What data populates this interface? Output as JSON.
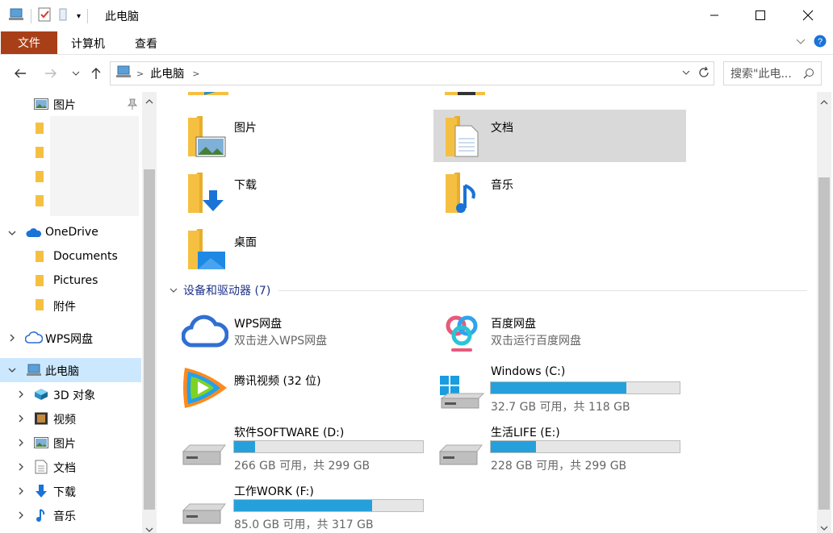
{
  "window": {
    "title": "此电脑",
    "qat_dropdown": "▾"
  },
  "ribbon": {
    "file_tab": "文件",
    "tabs": [
      "计算机",
      "查看"
    ]
  },
  "address": {
    "crumb": "此电脑",
    "search_placeholder": "搜索\"此电..."
  },
  "sidebar": {
    "items": [
      {
        "label": "图片",
        "pinned": true
      },
      {
        "label": "OneDrive"
      },
      {
        "label": "Documents"
      },
      {
        "label": "Pictures"
      },
      {
        "label": "附件"
      },
      {
        "label": "WPS网盘"
      },
      {
        "label": "此电脑"
      },
      {
        "label": "3D 对象"
      },
      {
        "label": "视频"
      },
      {
        "label": "图片"
      },
      {
        "label": "文档"
      },
      {
        "label": "下载"
      },
      {
        "label": "音乐"
      }
    ]
  },
  "folders": [
    {
      "label": "图片",
      "icon": "pictures-folder-icon"
    },
    {
      "label": "文档",
      "icon": "documents-folder-icon"
    },
    {
      "label": "下载",
      "icon": "downloads-folder-icon"
    },
    {
      "label": "音乐",
      "icon": "music-folder-icon"
    },
    {
      "label": "桌面",
      "icon": "desktop-folder-icon"
    }
  ],
  "devices_header": "设备和驱动器 (7)",
  "devices": [
    {
      "name": "WPS网盘",
      "sub": "双击进入WPS网盘"
    },
    {
      "name": "百度网盘",
      "sub": "双击运行百度网盘"
    },
    {
      "name": "腾讯视频 (32 位)"
    }
  ],
  "drives": [
    {
      "name": "Windows (C:)",
      "usage": "32.7 GB 可用，共 118 GB",
      "used_fraction": 0.72
    },
    {
      "name": "软件SOFTWARE (D:)",
      "usage": "266 GB 可用，共 299 GB",
      "used_fraction": 0.11
    },
    {
      "name": "生活LIFE (E:)",
      "usage": "228 GB 可用，共 299 GB",
      "used_fraction": 0.24
    },
    {
      "name": "工作WORK (F:)",
      "usage": "85.0 GB 可用，共 317 GB",
      "used_fraction": 0.73
    }
  ],
  "colors": {
    "file_tab": "#a83f18",
    "selected": "#cce8ff",
    "bar_fill": "#26a0da",
    "section_header": "#1e3287"
  }
}
